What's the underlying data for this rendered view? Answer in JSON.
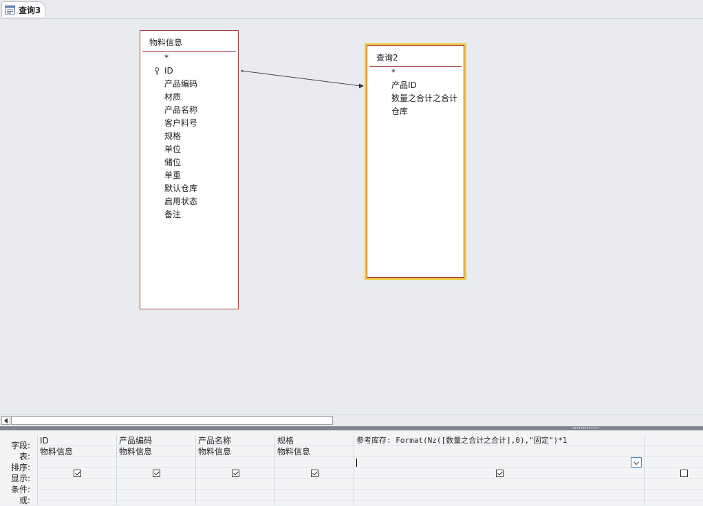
{
  "tab": {
    "label": "查询3"
  },
  "tables": {
    "wuliao": {
      "title": "物料信息",
      "fields": [
        "*",
        "ID",
        "产品编码",
        "材质",
        "产品名称",
        "客户料号",
        "规格",
        "单位",
        "储位",
        "单重",
        "默认仓库",
        "启用状态",
        "备注"
      ]
    },
    "query2": {
      "title": "查询2",
      "fields": [
        "*",
        "产品ID",
        "数量之合计之合计",
        "仓库"
      ]
    }
  },
  "grid": {
    "row_labels": [
      "字段:",
      "表:",
      "排序:",
      "显示:",
      "条件:",
      "或:"
    ],
    "columns": [
      {
        "field": "ID",
        "table": "物料信息",
        "show": true
      },
      {
        "field": "产品编码",
        "table": "物料信息",
        "show": true
      },
      {
        "field": "产品名称",
        "table": "物料信息",
        "show": true
      },
      {
        "field": "规格",
        "table": "物料信息",
        "show": true
      },
      {
        "field": "参考库存: Format(Nz([数量之合计之合计],0),\"固定\")*1",
        "table": "",
        "show": true
      },
      {
        "field": "",
        "table": "",
        "show": false
      }
    ]
  },
  "colors": {
    "selected_border": "#f3c843",
    "table_border": "#a33838"
  }
}
